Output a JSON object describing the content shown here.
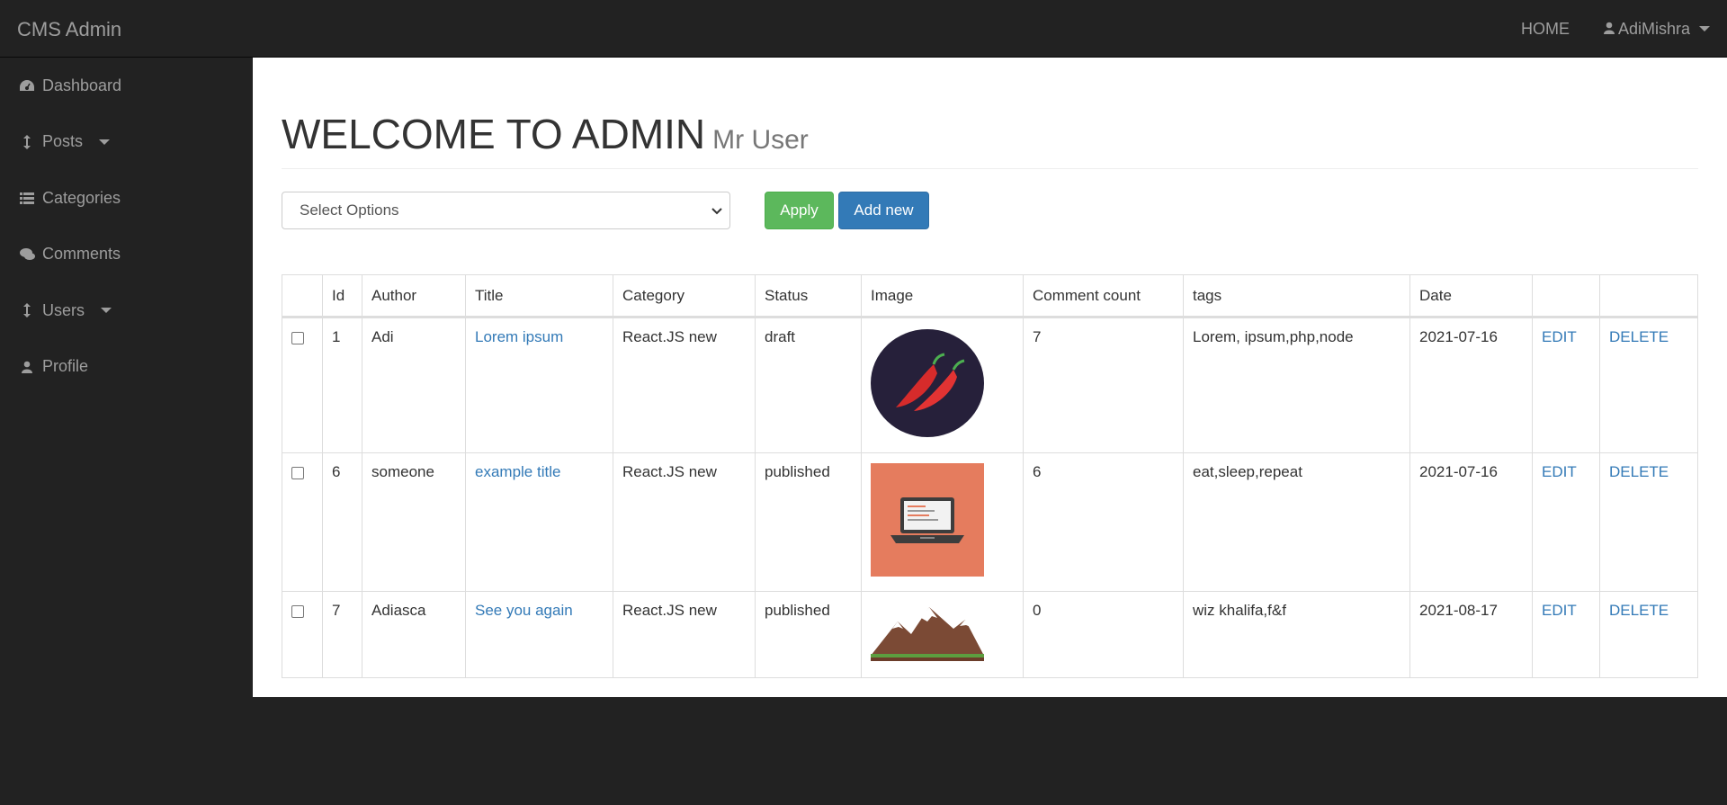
{
  "navbar": {
    "brand": "CMS Admin",
    "home": "HOME",
    "user": "AdiMishra"
  },
  "sidebar": {
    "items": [
      {
        "label": "Dashboard",
        "icon": "dashboard-icon"
      },
      {
        "label": "Posts",
        "icon": "arrows-v-icon"
      },
      {
        "label": "Categories",
        "icon": "list-icon"
      },
      {
        "label": "Comments",
        "icon": "comments-icon"
      },
      {
        "label": "Users",
        "icon": "arrows-v-icon"
      },
      {
        "label": "Profile",
        "icon": "user-icon"
      }
    ]
  },
  "page": {
    "title": "WELCOME TO ADMIN",
    "subtitle": "Mr User"
  },
  "toolbar": {
    "select_value": "Select Options",
    "apply_label": "Apply",
    "add_label": "Add new"
  },
  "table": {
    "headers": [
      "Id",
      "Author",
      "Title",
      "Category",
      "Status",
      "Image",
      "Comment count",
      "tags",
      "Date"
    ],
    "rows": [
      {
        "id": "1",
        "author": "Adi",
        "title": "Lorem ipsum",
        "category": "React.JS new",
        "status": "draft",
        "image": "chili-peppers",
        "comments": "7",
        "tags": "Lorem, ipsum,php,node",
        "date": "2021-07-16",
        "edit": "EDIT",
        "delete": "DELETE"
      },
      {
        "id": "6",
        "author": "someone",
        "title": "example title",
        "category": "React.JS new",
        "status": "published",
        "image": "laptop",
        "comments": "6",
        "tags": "eat,sleep,repeat",
        "date": "2021-07-16",
        "edit": "EDIT",
        "delete": "DELETE"
      },
      {
        "id": "7",
        "author": "Adiasca",
        "title": "See you again",
        "category": "React.JS new",
        "status": "published",
        "image": "mountains",
        "comments": "0",
        "tags": "wiz khalifa,f&f",
        "date": "2021-08-17",
        "edit": "EDIT",
        "delete": "DELETE"
      }
    ]
  },
  "colors": {
    "navbar_bg": "#222222",
    "link": "#337ab7",
    "apply_green": "#5cb85c",
    "add_blue": "#337ab7"
  }
}
